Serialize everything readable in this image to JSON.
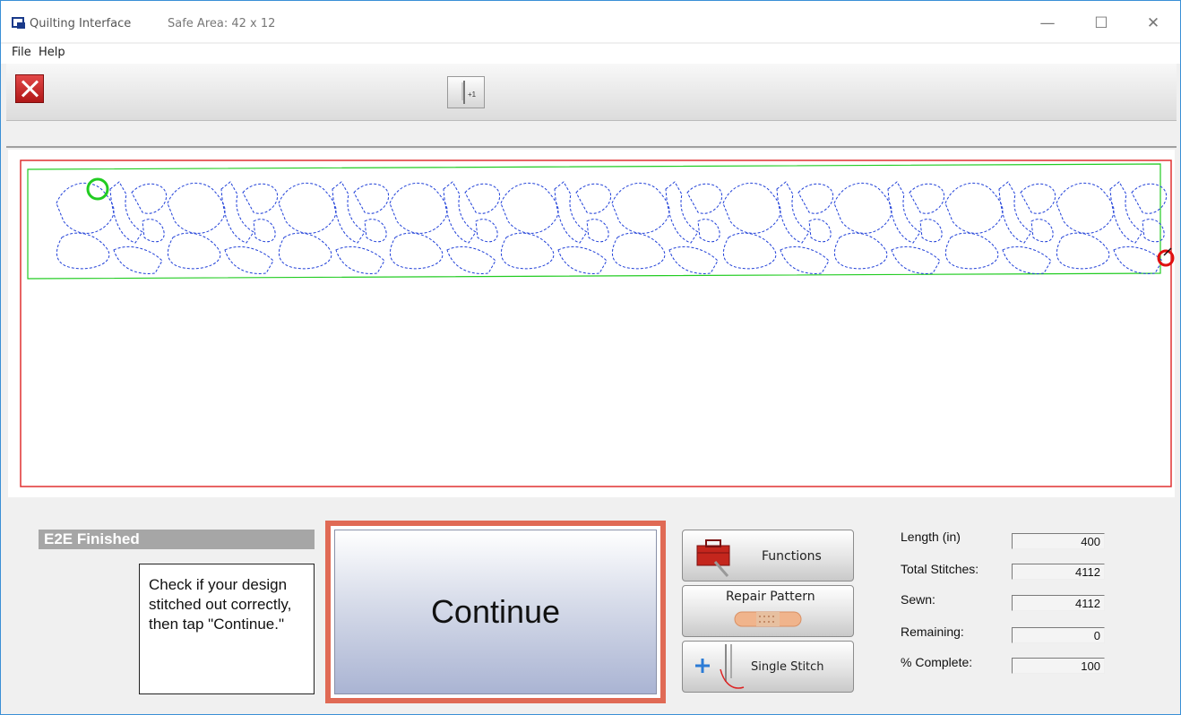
{
  "window": {
    "app_title": "Quilting Interface",
    "safe_area": "Safe Area: 42 x 12",
    "minimize_glyph": "—",
    "maximize_glyph": "☐",
    "close_glyph": "✕"
  },
  "menu": {
    "items": [
      "File",
      "Help"
    ]
  },
  "toolbar": {
    "exit_icon": "red-x-icon",
    "needle_icon": "needle-plus-one-icon",
    "needle_badge": "+1"
  },
  "status": {
    "title": "E2E Finished",
    "message": "Check if your design stitched out correctly, then tap \"Continue.\""
  },
  "buttons": {
    "continue": "Continue",
    "functions": "Functions",
    "repair_pattern": "Repair Pattern",
    "single_stitch": "Single Stitch"
  },
  "stats": [
    {
      "label": "Length (in)",
      "value": "400"
    },
    {
      "label": "Total Stitches:",
      "value": "4112"
    },
    {
      "label": "Sewn:",
      "value": "4112"
    },
    {
      "label": "Remaining:",
      "value": "0"
    },
    {
      "label": "% Complete:",
      "value": "100"
    }
  ],
  "colors": {
    "safe_area_border": "#e03030",
    "pattern_bounds": "#22cc22",
    "stitch_path": "#1f3fd8",
    "start_marker": "#22cc22",
    "end_marker": "#e01010",
    "continue_frame": "#e06a55"
  }
}
